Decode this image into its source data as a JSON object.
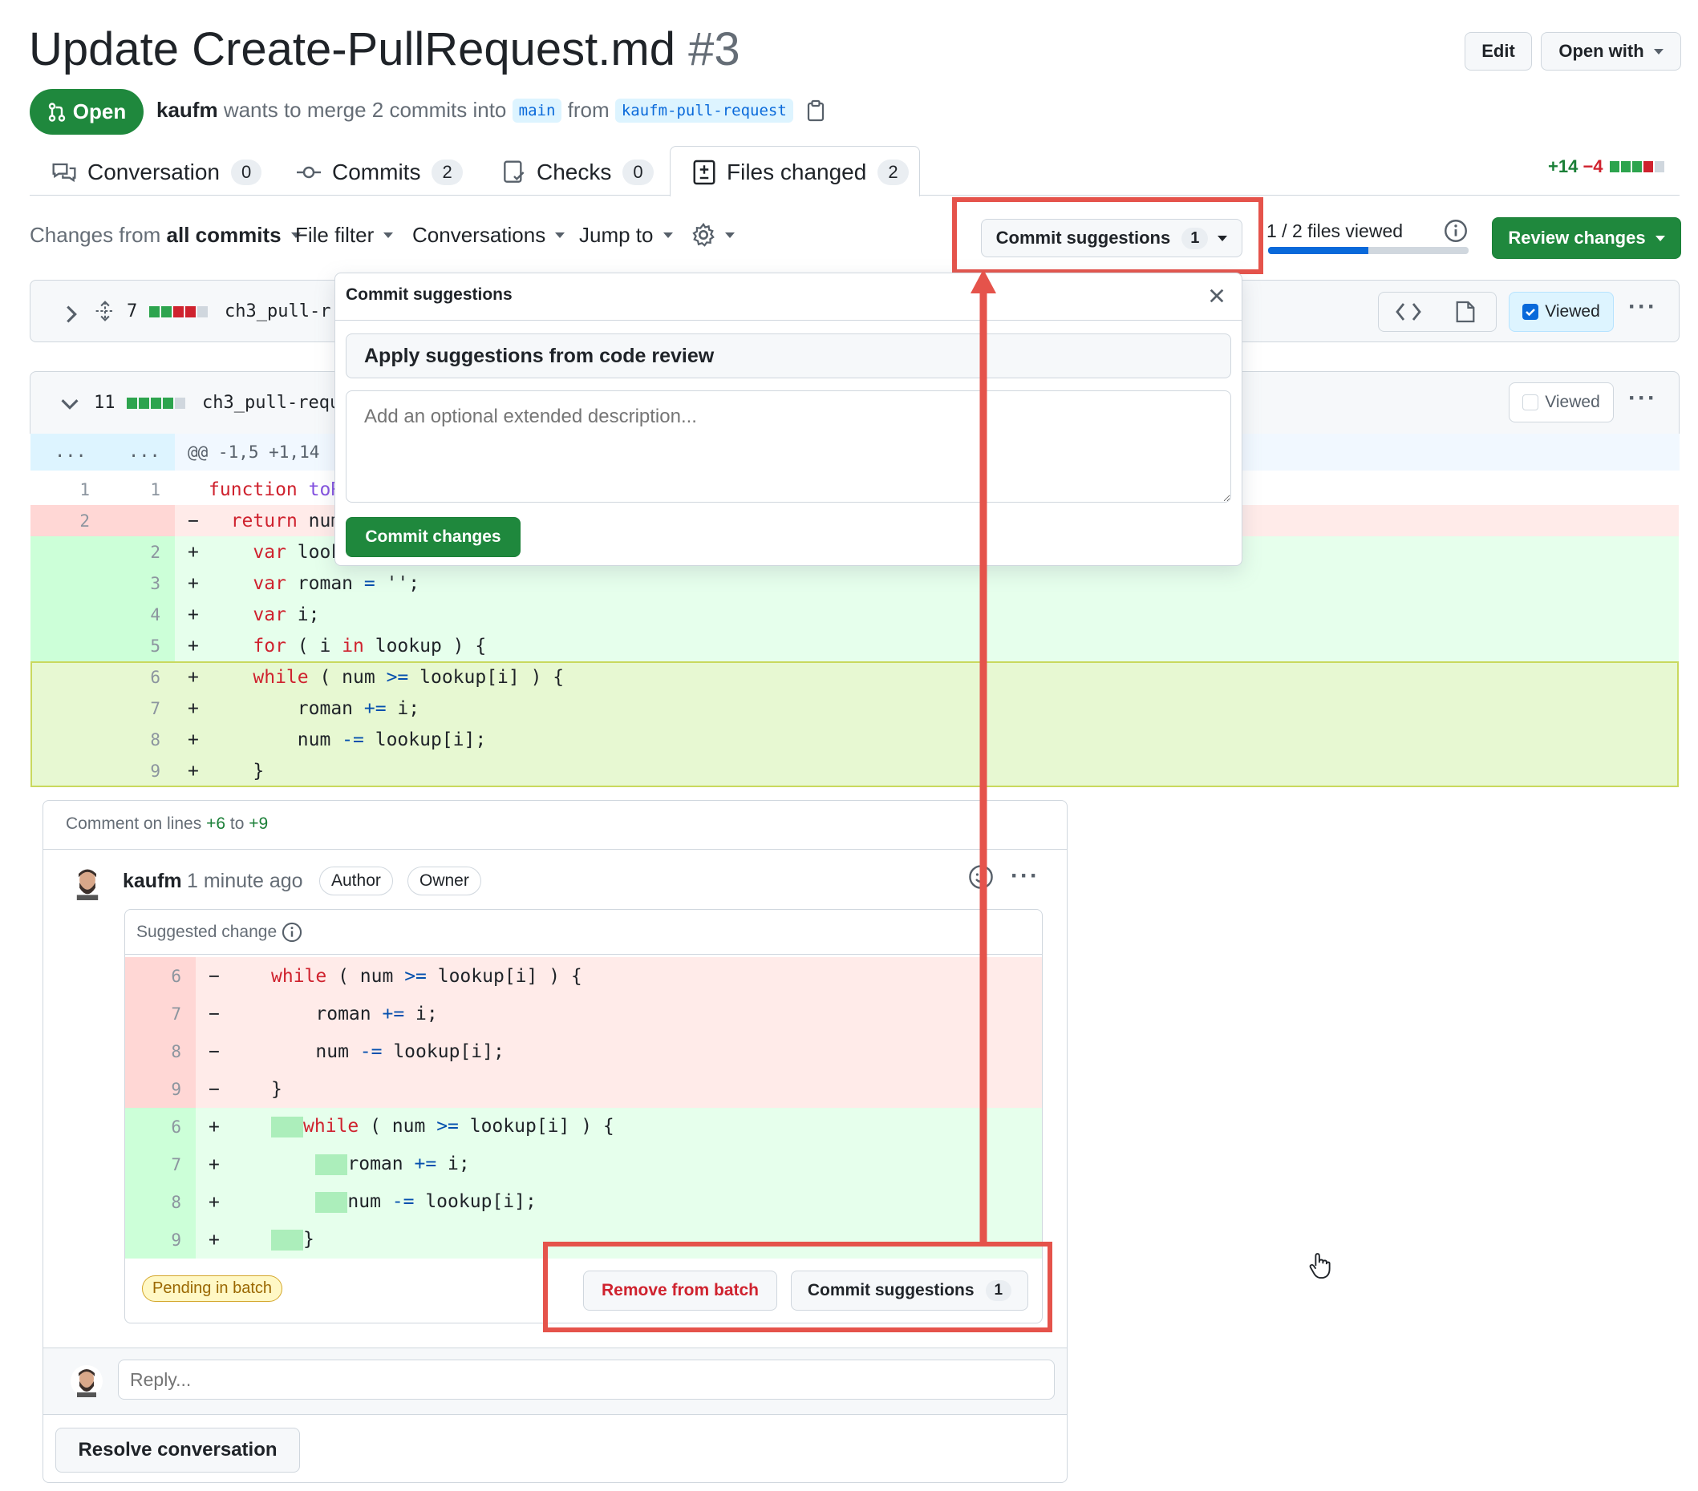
{
  "header": {
    "title": "Update Create-PullRequest.md",
    "number": "#3",
    "edit_label": "Edit",
    "open_with_label": "Open with",
    "state_label": "Open",
    "author": "kaufm",
    "merge_text": "wants to merge 2 commits into",
    "base_branch": "main",
    "from_text": "from",
    "head_branch": "kaufm-pull-request"
  },
  "tabs": [
    {
      "label": "Conversation",
      "count": "0"
    },
    {
      "label": "Commits",
      "count": "2"
    },
    {
      "label": "Checks",
      "count": "0"
    },
    {
      "label": "Files changed",
      "count": "2"
    }
  ],
  "diffstat": {
    "additions": "+14",
    "deletions": "−4"
  },
  "toolbar": {
    "changes_prefix": "Changes from",
    "changes_value": "all commits",
    "file_filter": "File filter",
    "conversations": "Conversations",
    "jump_to": "Jump to",
    "commit_suggestions_label": "Commit suggestions",
    "commit_suggestions_count": "1",
    "files_viewed": "1 / 2 files viewed",
    "files_viewed_progress": 0.5,
    "review_changes": "Review changes"
  },
  "files": [
    {
      "changes": "7",
      "name": "ch3_pull-r",
      "viewed_label": "Viewed",
      "viewed": true,
      "expanded": false
    },
    {
      "changes": "11",
      "name": "ch3_pull-requ",
      "viewed_label": "Viewed",
      "viewed": false,
      "expanded": true
    }
  ],
  "hunk": {
    "expander": "...",
    "header": "@@ -1,5 +1,14"
  },
  "diff_lines": [
    {
      "old": "1",
      "new": "1",
      "sign": "",
      "type": "ctx"
    },
    {
      "old": "2",
      "new": "",
      "sign": "−",
      "type": "del"
    },
    {
      "old": "",
      "new": "2",
      "sign": "+",
      "type": "add"
    },
    {
      "old": "",
      "new": "3",
      "sign": "+",
      "type": "add"
    },
    {
      "old": "",
      "new": "4",
      "sign": "+",
      "type": "add"
    },
    {
      "old": "",
      "new": "5",
      "sign": "+",
      "type": "add"
    },
    {
      "old": "",
      "new": "6",
      "sign": "+",
      "type": "sel"
    },
    {
      "old": "",
      "new": "7",
      "sign": "+",
      "type": "sel"
    },
    {
      "old": "",
      "new": "8",
      "sign": "+",
      "type": "sel"
    },
    {
      "old": "",
      "new": "9",
      "sign": "+",
      "type": "sel"
    }
  ],
  "popup": {
    "title": "Commit suggestions",
    "message": "Apply suggestions from code review",
    "description_placeholder": "Add an optional extended description...",
    "commit_button": "Commit changes"
  },
  "comment": {
    "context_prefix": "Comment on lines",
    "from_line": "+6",
    "to_text": "to",
    "to_line": "+9",
    "author": "kaufm",
    "time": "1 minute ago",
    "badge_author": "Author",
    "badge_owner": "Owner",
    "suggested_change_label": "Suggested change",
    "suggestion_lines": [
      {
        "num": "6",
        "sign": "−",
        "type": "del"
      },
      {
        "num": "7",
        "sign": "−",
        "type": "del"
      },
      {
        "num": "8",
        "sign": "−",
        "type": "del"
      },
      {
        "num": "9",
        "sign": "−",
        "type": "del"
      },
      {
        "num": "6",
        "sign": "+",
        "type": "add"
      },
      {
        "num": "7",
        "sign": "+",
        "type": "add"
      },
      {
        "num": "8",
        "sign": "+",
        "type": "add"
      },
      {
        "num": "9",
        "sign": "+",
        "type": "add"
      }
    ],
    "pending_label": "Pending in batch",
    "remove_button": "Remove from batch",
    "commit_button": "Commit suggestions",
    "commit_count": "1",
    "reply_placeholder": "Reply...",
    "resolve_button": "Resolve conversation"
  },
  "colors": {
    "green": "#1f883d",
    "red_highlight": "#e5534b",
    "add_bg": "#e6ffec",
    "del_bg": "#ffebe9",
    "selected_bg": "#e7f8d2",
    "blue": "#0969da"
  }
}
